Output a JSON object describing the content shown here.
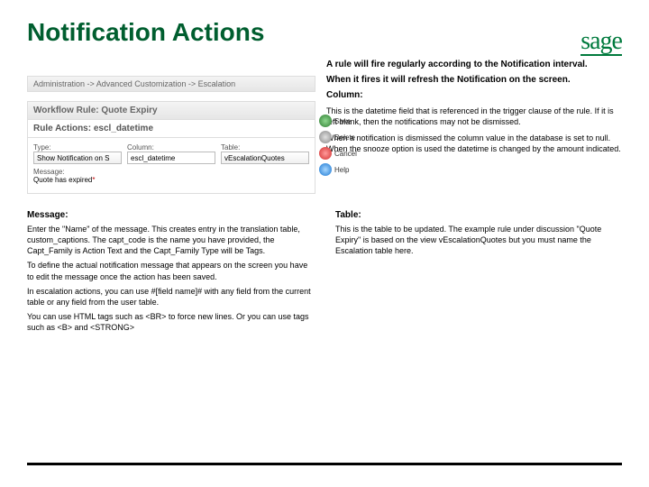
{
  "title": "Notification Actions",
  "logo": {
    "text": "sage"
  },
  "intro": {
    "line1": "A rule will fire regularly according to the Notification interval.",
    "line2": "When it fires it will refresh the Notification on the screen.",
    "column_label": "Column:",
    "column_p1": "This is the datetime field that is referenced in the trigger clause of the rule. If it is left blank, then the notifications may not be dismissed.",
    "column_p2": "When a notification is dismissed the column value in the database is set to null. When the snooze option is used the datetime is changed by the amount indicated."
  },
  "crm": {
    "breadcrumb": "Administration -> Advanced Customization -> Escalation",
    "workflow_rule": "Workflow Rule: Quote Expiry",
    "rule_actions": "Rule Actions: escl_datetime",
    "labels": {
      "type": "Type:",
      "column": "Column:",
      "table": "Table:",
      "message": "Message:"
    },
    "values": {
      "type": "Show Notification on S",
      "column": "escl_datetime",
      "table": "vEscalationQuotes",
      "message": "Quote has expired"
    },
    "buttons": {
      "save": "Save",
      "delete": "Delete",
      "cancel": "Cancel",
      "help": "Help"
    }
  },
  "msg": {
    "title": "Message:",
    "p1": "Enter the \"Name\" of the message. This creates entry in the translation table, custom_captions. The capt_code is the name you have provided, the Capt_Family is Action Text and the Capt_Family Type will be Tags.",
    "p2": "To define the actual notification message that appears on the screen you have to edit the message once the action has been saved.",
    "p3": "In escalation actions, you can use #[field name]# with any field from the current table or any field from the user table.",
    "p4": "You can use HTML tags such as <BR> to force new lines. Or you can use tags such as <B> and <STRONG>"
  },
  "table": {
    "title": "Table:",
    "p1": "This is the table to be updated. The example rule under discussion \"Quote Expiry\" is based on the view vEscalationQuotes but you must name the Escalation table here."
  }
}
